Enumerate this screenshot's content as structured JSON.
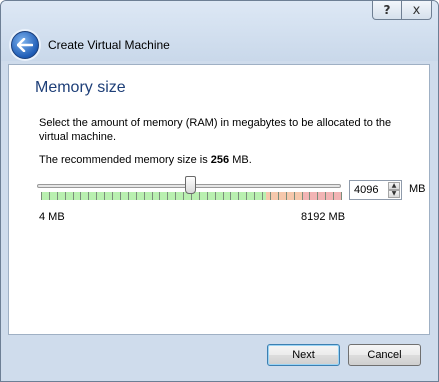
{
  "caption": {
    "help_glyph": "?",
    "close_glyph": "x"
  },
  "header": {
    "title": "Create Virtual Machine",
    "back_icon": "back-arrow-icon"
  },
  "page": {
    "title": "Memory size",
    "description": "Select the amount of memory (RAM) in megabytes to be allocated to the virtual machine.",
    "recommend_prefix": "The recommended memory size is ",
    "recommend_value": "256",
    "recommend_suffix": " MB."
  },
  "memory": {
    "value": "4096",
    "unit": "MB",
    "min_label": "4 MB",
    "max_label": "8192 MB",
    "min_mb": 4,
    "max_mb": 8192,
    "selected_mb": 4096,
    "zones": [
      {
        "name": "safe",
        "color": "#b9f0b0",
        "from_mb": 4,
        "to_mb": 6144
      },
      {
        "name": "warning",
        "color": "#f6c8ac",
        "from_mb": 6144,
        "to_mb": 7168
      },
      {
        "name": "danger",
        "color": "#f2b4b4",
        "from_mb": 7168,
        "to_mb": 8192
      }
    ]
  },
  "footer": {
    "next_label": "Next",
    "cancel_label": "Cancel"
  },
  "colors": {
    "title_blue": "#1e3f78",
    "accent_blue": "#1e5cb6"
  }
}
